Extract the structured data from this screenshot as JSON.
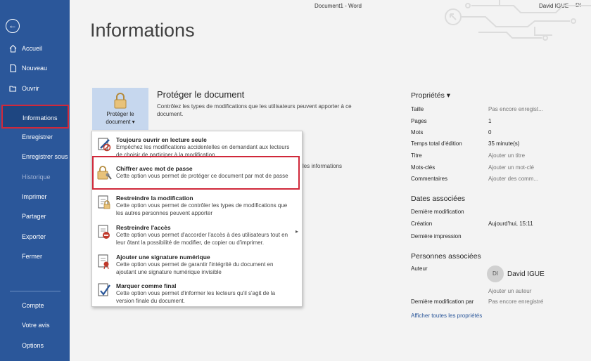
{
  "window": {
    "title": "Document1 - Word",
    "user_name": "David IGUE",
    "user_initials": "DI"
  },
  "sidebar": {
    "back_icon": "back-arrow-icon",
    "items": [
      {
        "label": "Accueil",
        "icon": "home-icon"
      },
      {
        "label": "Nouveau",
        "icon": "new-document-icon"
      },
      {
        "label": "Ouvrir",
        "icon": "folder-open-icon"
      },
      {
        "label": "Informations"
      },
      {
        "label": "Enregistrer"
      },
      {
        "label": "Enregistrer sous"
      },
      {
        "label": "Historique"
      },
      {
        "label": "Imprimer"
      },
      {
        "label": "Partager"
      },
      {
        "label": "Exporter"
      },
      {
        "label": "Fermer"
      },
      {
        "label": "Compte"
      },
      {
        "label": "Votre avis"
      },
      {
        "label": "Options"
      }
    ]
  },
  "main": {
    "page_title": "Informations",
    "protect": {
      "button_line1": "Protéger le",
      "button_line2": "document ▾",
      "title": "Protéger le document",
      "description": "Contrôlez les types de modifications que les utilisateurs peuvent apporter à ce document.",
      "behind_text": "les informations"
    },
    "menu": [
      {
        "title": "Toujours ouvrir en lecture seule",
        "desc": "Empêchez les modifications accidentelles en demandant aux lecteurs de choisir de participer à la modification.",
        "icon": "read-only-icon"
      },
      {
        "title": "Chiffrer avec mot de passe",
        "desc": "Cette option vous permet de protéger ce document par mot de passe",
        "icon": "lock-key-icon"
      },
      {
        "title": "Restreindre la modification",
        "desc": "Cette option vous permet de contrôler les types de modifications que les autres personnes peuvent apporter",
        "icon": "restrict-edit-icon"
      },
      {
        "title": "Restreindre l'accès",
        "desc": "Cette option vous permet d'accorder l'accès à des utilisateurs tout en leur ôtant la possibilité de modifier, de copier ou d'imprimer.",
        "icon": "restrict-access-icon"
      },
      {
        "title": "Ajouter une signature numérique",
        "desc": "Cette option vous permet de garantir l'intégrité du document en ajoutant une signature numérique invisible",
        "icon": "signature-icon"
      },
      {
        "title": "Marquer comme final",
        "desc": "Cette option vous permet d'informer les lecteurs qu'il s'agit de la version finale du document.",
        "icon": "mark-final-icon"
      }
    ]
  },
  "properties": {
    "title": "Propriétés ▾",
    "rows": [
      {
        "key": "Taille",
        "value": "Pas encore enregist..."
      },
      {
        "key": "Pages",
        "value": "1"
      },
      {
        "key": "Mots",
        "value": "0"
      },
      {
        "key": "Temps total d'édition",
        "value": "35 minute(s)"
      },
      {
        "key": "Titre",
        "value": "Ajouter un titre"
      },
      {
        "key": "Mots-clés",
        "value": "Ajouter un mot-clé"
      },
      {
        "key": "Commentaires",
        "value": "Ajouter des comm..."
      }
    ],
    "dates_title": "Dates associées",
    "dates": [
      {
        "key": "Dernière modification",
        "value": ""
      },
      {
        "key": "Création",
        "value": "Aujourd'hui, 15:11"
      },
      {
        "key": "Dernière impression",
        "value": ""
      }
    ],
    "people_title": "Personnes associées",
    "author_label": "Auteur",
    "author_initials": "DI",
    "author_name": "David IGUE",
    "add_author": "Ajouter un auteur",
    "last_modified_by_label": "Dernière modification par",
    "last_modified_by_value": "Pas encore enregistré",
    "show_all_link": "Afficher toutes les propriétés"
  }
}
